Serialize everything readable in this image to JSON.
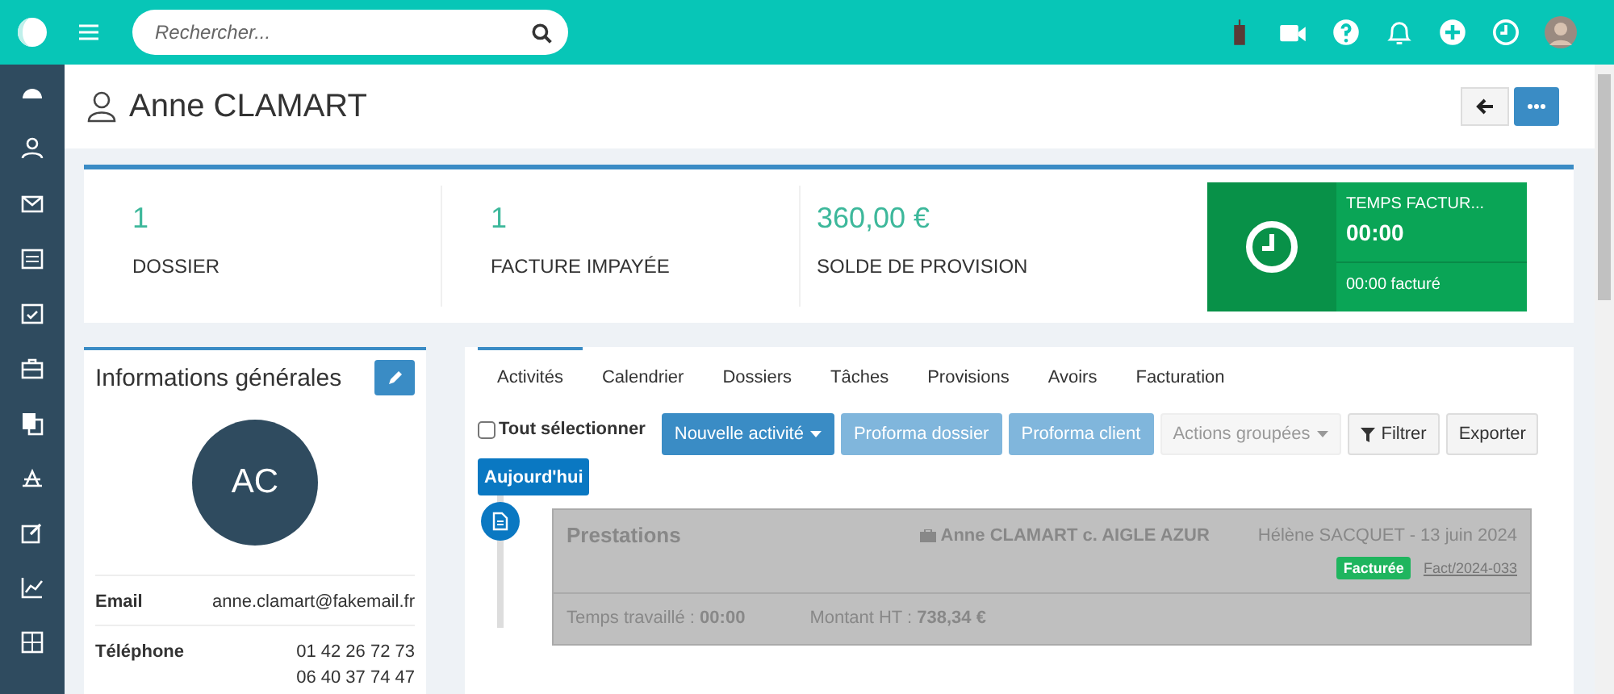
{
  "topbar": {
    "search": {
      "placeholder": "Rechercher..."
    }
  },
  "header": {
    "title": "Anne CLAMART"
  },
  "stats": [
    {
      "value": "1",
      "label": "DOSSIER"
    },
    {
      "value": "1",
      "label": "FACTURE IMPAYÉE"
    },
    {
      "value": "360,00 €",
      "label": "SOLDE DE PROVISION"
    }
  ],
  "timer": {
    "title": "TEMPS FACTUR...",
    "time": "00:00",
    "billed": "00:00 facturé"
  },
  "info": {
    "title": "Informations générales",
    "initials": "AC",
    "fields": [
      {
        "label": "Email",
        "values": [
          "anne.clamart@fakemail.fr"
        ]
      },
      {
        "label": "Téléphone",
        "values": [
          "01 42 26 72 73",
          "06 40 37 74 47"
        ]
      }
    ]
  },
  "tabs": [
    {
      "label": "Activités",
      "selected": true
    },
    {
      "label": "Calendrier",
      "selected": false
    },
    {
      "label": "Dossiers",
      "selected": false
    },
    {
      "label": "Tâches",
      "selected": false
    },
    {
      "label": "Provisions",
      "selected": false
    },
    {
      "label": "Avoirs",
      "selected": false
    },
    {
      "label": "Facturation",
      "selected": false
    }
  ],
  "select_all": {
    "label": "Tout sélectionner",
    "checked": false
  },
  "actions": [
    {
      "label": "Nouvelle activité",
      "kind": "dropdown-primary"
    },
    {
      "label": "Proforma dossier",
      "kind": "light"
    },
    {
      "label": "Proforma client",
      "kind": "light"
    },
    {
      "label": "Actions groupées",
      "kind": "dropdown-disabled"
    },
    {
      "label": "Filtrer",
      "kind": "filter"
    },
    {
      "label": "Exporter",
      "kind": "default"
    }
  ],
  "today": "Aujourd'hui",
  "entry": {
    "title": "Prestations",
    "case": "Anne CLAMART c. AIGLE AZUR",
    "author_date": "Hélène SACQUET - 13 juin 2024",
    "status": "Facturée",
    "invoice": "Fact/2024-033",
    "worked_label": "Temps travaillé :",
    "worked": "00:00",
    "amount_label": "Montant HT :",
    "amount": "738,34 €"
  }
}
